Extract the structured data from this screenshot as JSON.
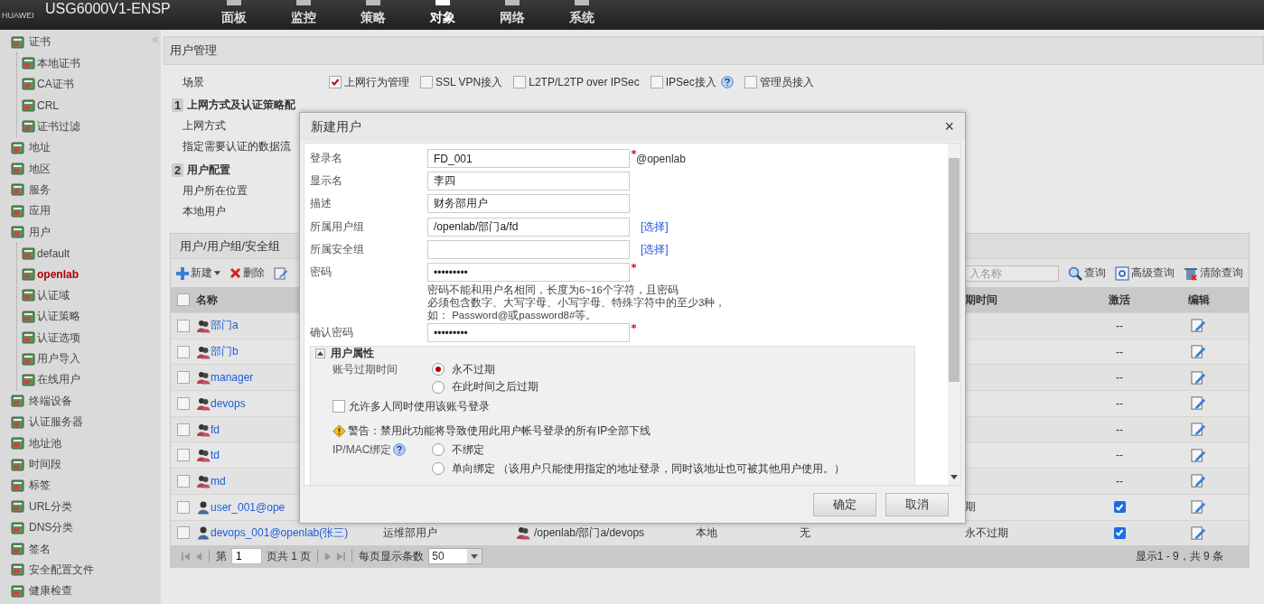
{
  "header": {
    "logo": "HUAWEI",
    "device": "USG6000V1-ENSP",
    "nav": [
      {
        "label": "面板",
        "selected": false
      },
      {
        "label": "监控",
        "selected": false
      },
      {
        "label": "策略",
        "selected": false
      },
      {
        "label": "对象",
        "selected": true
      },
      {
        "label": "网络",
        "selected": false
      },
      {
        "label": "系统",
        "selected": false
      }
    ]
  },
  "sidebar": {
    "collapse": "«",
    "items": [
      {
        "label": "证书",
        "selected": false,
        "children": [
          {
            "label": "本地证书",
            "selected": false
          },
          {
            "label": "CA证书",
            "selected": false
          },
          {
            "label": "CRL",
            "selected": false
          },
          {
            "label": "证书过滤",
            "selected": false
          }
        ]
      },
      {
        "label": "地址",
        "selected": false
      },
      {
        "label": "地区",
        "selected": false
      },
      {
        "label": "服务",
        "selected": false
      },
      {
        "label": "应用",
        "selected": false
      },
      {
        "label": "用户",
        "selected": false,
        "children": [
          {
            "label": "default",
            "selected": false
          },
          {
            "label": "openlab",
            "selected": true
          },
          {
            "label": "认证域",
            "selected": false
          },
          {
            "label": "认证策略",
            "selected": false
          },
          {
            "label": "认证选项",
            "selected": false
          },
          {
            "label": "用户导入",
            "selected": false
          },
          {
            "label": "在线用户",
            "selected": false
          }
        ]
      },
      {
        "label": "终端设备",
        "selected": false
      },
      {
        "label": "认证服务器",
        "selected": false
      },
      {
        "label": "地址池",
        "selected": false
      },
      {
        "label": "时间段",
        "selected": false
      },
      {
        "label": "标签",
        "selected": false
      },
      {
        "label": "URL分类",
        "selected": false
      },
      {
        "label": "DNS分类",
        "selected": false
      },
      {
        "label": "签名",
        "selected": false
      },
      {
        "label": "安全配置文件",
        "selected": false
      },
      {
        "label": "健康检查",
        "selected": false
      }
    ]
  },
  "panel": {
    "title": "用户管理",
    "scene_label": "场景",
    "scenes": [
      {
        "label": "上网行为管理",
        "checked": true,
        "help": false
      },
      {
        "label": "SSL VPN接入",
        "checked": false,
        "help": false
      },
      {
        "label": "L2TP/L2TP over IPSec",
        "checked": false,
        "help": false
      },
      {
        "label": "IPSec接入",
        "checked": false,
        "help": true
      },
      {
        "label": "管理员接入",
        "checked": false,
        "help": false
      }
    ],
    "sections": [
      {
        "number": "1",
        "title": "上网方式及认证策略配",
        "rows": [
          "上网方式",
          "指定需要认证的数据流"
        ]
      },
      {
        "number": "2",
        "title": "用户配置",
        "rows": [
          "用户所在位置",
          "本地用户"
        ]
      }
    ]
  },
  "user_table": {
    "title": "用户/用户组/安全组",
    "toolbar": {
      "new": "新建",
      "delete": "删除",
      "search_placeholder": "入名称",
      "query": "查询",
      "advanced": "高级查询",
      "clear": "清除查询"
    },
    "columns": {
      "select_all_checked": false,
      "name": "名称",
      "column_7": "期时间",
      "active": "激活",
      "edit": "编辑"
    },
    "rows": [
      {
        "kind": "group",
        "name": "部门a",
        "selected": false,
        "active": {
          "kind": "dash",
          "text": "--"
        }
      },
      {
        "kind": "group",
        "name": "部门b",
        "selected": false,
        "active": {
          "kind": "dash",
          "text": "--"
        }
      },
      {
        "kind": "group",
        "name": "manager",
        "selected": false,
        "active": {
          "kind": "dash",
          "text": "--"
        }
      },
      {
        "kind": "group",
        "name": "devops",
        "selected": false,
        "active": {
          "kind": "dash",
          "text": "--"
        }
      },
      {
        "kind": "group",
        "name": "fd",
        "selected": false,
        "active": {
          "kind": "dash",
          "text": "--"
        }
      },
      {
        "kind": "group",
        "name": "td",
        "selected": false,
        "active": {
          "kind": "dash",
          "text": "--"
        }
      },
      {
        "kind": "group",
        "name": "md",
        "selected": false,
        "active": {
          "kind": "dash",
          "text": "--"
        }
      },
      {
        "kind": "user",
        "name": "user_001@ope",
        "selected": false,
        "column_7": "期",
        "active": {
          "kind": "check",
          "checked": true
        }
      },
      {
        "kind": "user",
        "name": "devops_001@openlab(张三)",
        "selected": false,
        "column_3": "运维部用户",
        "column_4": "/openlab/部门a/devops",
        "column_5": "本地",
        "column_6": "无",
        "column_7": "永不过期",
        "active": {
          "kind": "check",
          "checked": true
        }
      }
    ],
    "pager": {
      "page_prefix": "第",
      "page": "1",
      "page_suffix": "页共 1 页",
      "per_page_label": "每页显示条数",
      "per_page": "50",
      "summary": "显示1 - 9，共 9 条"
    }
  },
  "dialog": {
    "title": "新建用户",
    "close": "×",
    "fields": [
      {
        "label": "登录名",
        "value": "FD_001",
        "required": true,
        "suffix": "@openlab"
      },
      {
        "label": "显示名",
        "value": "李四",
        "required": false
      },
      {
        "label": "描述",
        "value": "财务部用户",
        "required": false
      },
      {
        "label": "所属用户组",
        "value": "/openlab/部门a/fd",
        "required": false,
        "link": "[选择]"
      },
      {
        "label": "所属安全组",
        "required": false,
        "link": "[选择]"
      },
      {
        "label": "密码",
        "value": "•••••••••",
        "required": true
      }
    ],
    "hint_lines": [
      "密码不能和用户名相同，长度为6~16个字符，且密码",
      "必须包含数字、大写字母、小写字母、特殊字符中的至少3种，",
      "如： Password@或password8#等。"
    ],
    "confirm": {
      "label": "确认密码",
      "value": "•••••••••",
      "required": true
    },
    "attributes": {
      "title": "用户属性",
      "expanded": true,
      "expiry_label": "账号过期时间",
      "expiry_options": [
        {
          "label": "永不过期",
          "selected": true
        },
        {
          "label": "在此时间之后过期",
          "selected": false
        }
      ],
      "multi_login": {
        "label": "允许多人同时使用该账号登录",
        "checked": false
      },
      "warning": "警告：禁用此功能将导致使用此用户帐号登录的所有IP全部下线",
      "binding_label": "IP/MAC绑定",
      "binding_options": [
        {
          "label": "不绑定",
          "selected": false
        },
        {
          "label": "单向绑定 （该用户只能使用指定的地址登录，同时该地址也可被其他用户使用。）",
          "selected": false
        }
      ]
    },
    "buttons": [
      "确定",
      "取消"
    ]
  }
}
